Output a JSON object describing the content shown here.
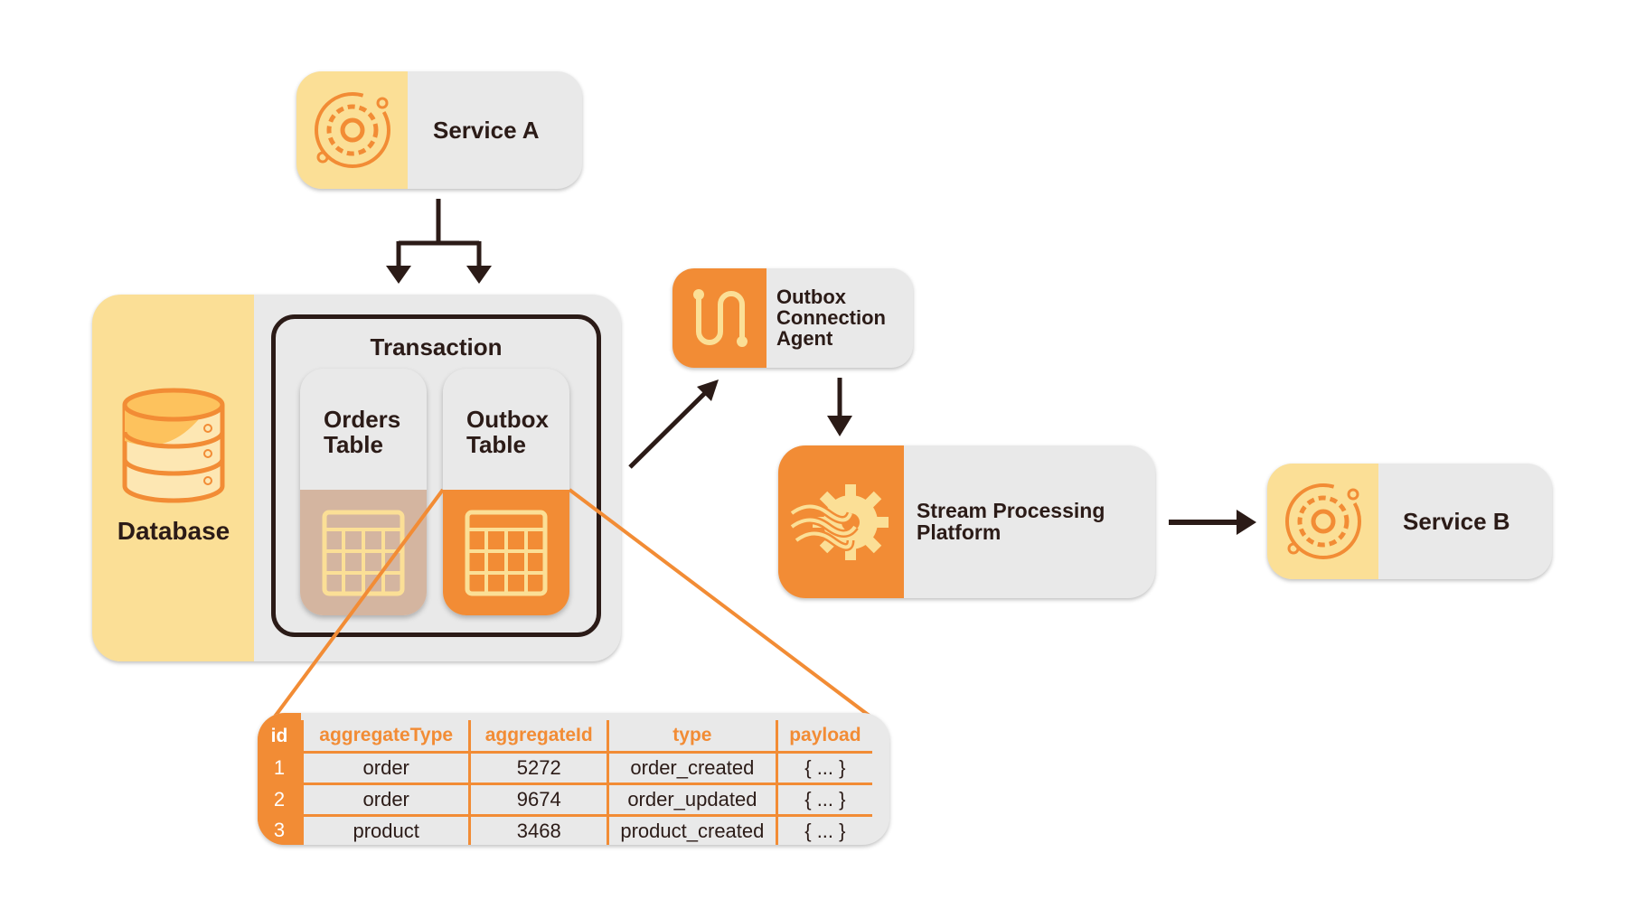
{
  "colors": {
    "orange": "#f28c35",
    "yellow": "#fbdf96",
    "light_grey": "#e9e9e9",
    "dark": "#2b1b17",
    "tan": "#d4b5a0"
  },
  "service_a": {
    "label": "Service A",
    "icon": "gear-orbit-icon"
  },
  "database": {
    "label": "Database",
    "icon": "database-icon",
    "transaction": {
      "label": "Transaction",
      "tables": [
        {
          "label": "Orders Table",
          "icon": "table-grid-icon"
        },
        {
          "label": "Outbox Table",
          "icon": "table-grid-icon"
        }
      ]
    }
  },
  "outbox_agent": {
    "label": "Outbox Connection Agent",
    "icon": "path-connector-icon"
  },
  "stream_platform": {
    "label": "Stream Processing Platform",
    "icon": "gear-waves-icon"
  },
  "service_b": {
    "label": "Service B",
    "icon": "gear-orbit-icon"
  },
  "outbox_table": {
    "columns": [
      "id",
      "aggregateType",
      "aggregateId",
      "type",
      "payload"
    ],
    "rows": [
      [
        "1",
        "order",
        "5272",
        "order_created",
        "{ ... }"
      ],
      [
        "2",
        "order",
        "9674",
        "order_updated",
        "{ ... }"
      ],
      [
        "3",
        "product",
        "3468",
        "product_created",
        "{ ... }"
      ]
    ]
  }
}
